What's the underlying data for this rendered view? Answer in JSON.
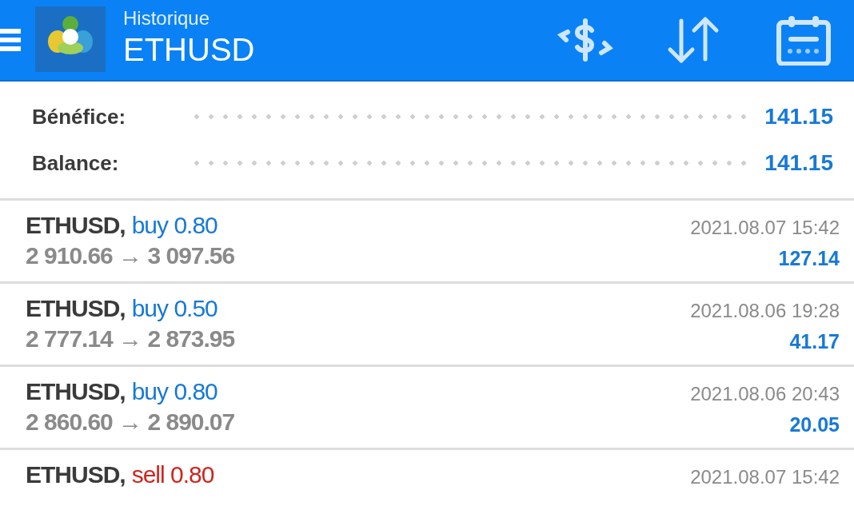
{
  "header": {
    "subtitle": "Historique",
    "title": "ETHUSD"
  },
  "summary": [
    {
      "label": "Bénéfice:",
      "value": "141.15"
    },
    {
      "label": "Balance:",
      "value": "141.15"
    }
  ],
  "trades": [
    {
      "symbol": "ETHUSD,",
      "kind": "buy",
      "order": "buy 0.80",
      "prices": "2 910.66 → 3 097.56",
      "time": "2021.08.07 15:42",
      "profit": "127.14"
    },
    {
      "symbol": "ETHUSD,",
      "kind": "buy",
      "order": "buy 0.50",
      "prices": "2 777.14 → 2 873.95",
      "time": "2021.08.06 19:28",
      "profit": "41.17"
    },
    {
      "symbol": "ETHUSD,",
      "kind": "buy",
      "order": "buy 0.80",
      "prices": "2 860.60 → 2 890.07",
      "time": "2021.08.06 20:43",
      "profit": "20.05"
    },
    {
      "symbol": "ETHUSD,",
      "kind": "sell",
      "order": "sell 0.80",
      "time": "2021.08.07 15:42"
    }
  ]
}
